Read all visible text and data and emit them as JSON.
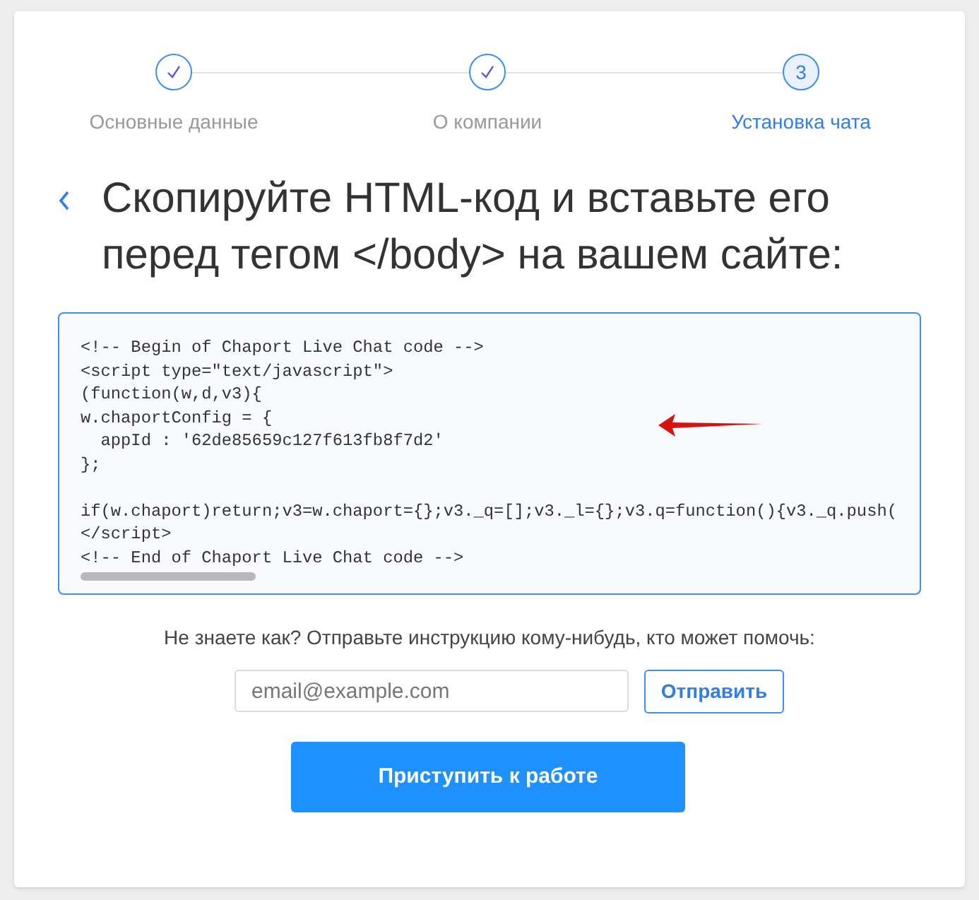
{
  "steps": [
    {
      "label": "Основные данные",
      "completed": true,
      "selected": false
    },
    {
      "label": "О компании",
      "completed": true,
      "selected": false
    },
    {
      "label": "Установка чата",
      "completed": false,
      "number": "3",
      "selected": true
    }
  ],
  "heading": "Скопируйте HTML-код и вставьте его перед тегом </body> на вашем сайте:",
  "code_blocks": [
    [
      "<!-- Begin of Chaport Live Chat code -->",
      "<script type=\"text/javascript\">",
      "(function(w,d,v3){",
      "w.chaportConfig = {",
      "  appId : '62de85659c127f613fb8f7d2'",
      "};"
    ],
    [
      "if(w.chaport)return;v3=w.chaport={};v3._q=[];v3._l={};v3.q=function(){v3._q.push(",
      "</script>",
      "<!-- End of Chaport Live Chat code -->"
    ]
  ],
  "help_text": "Не знаете как? Отправьте инструкцию кому-нибудь, кто может помочь:",
  "email_field": {
    "placeholder": "email@example.com"
  },
  "send_button": "Отправить",
  "start_button": "Приступить к работе"
}
